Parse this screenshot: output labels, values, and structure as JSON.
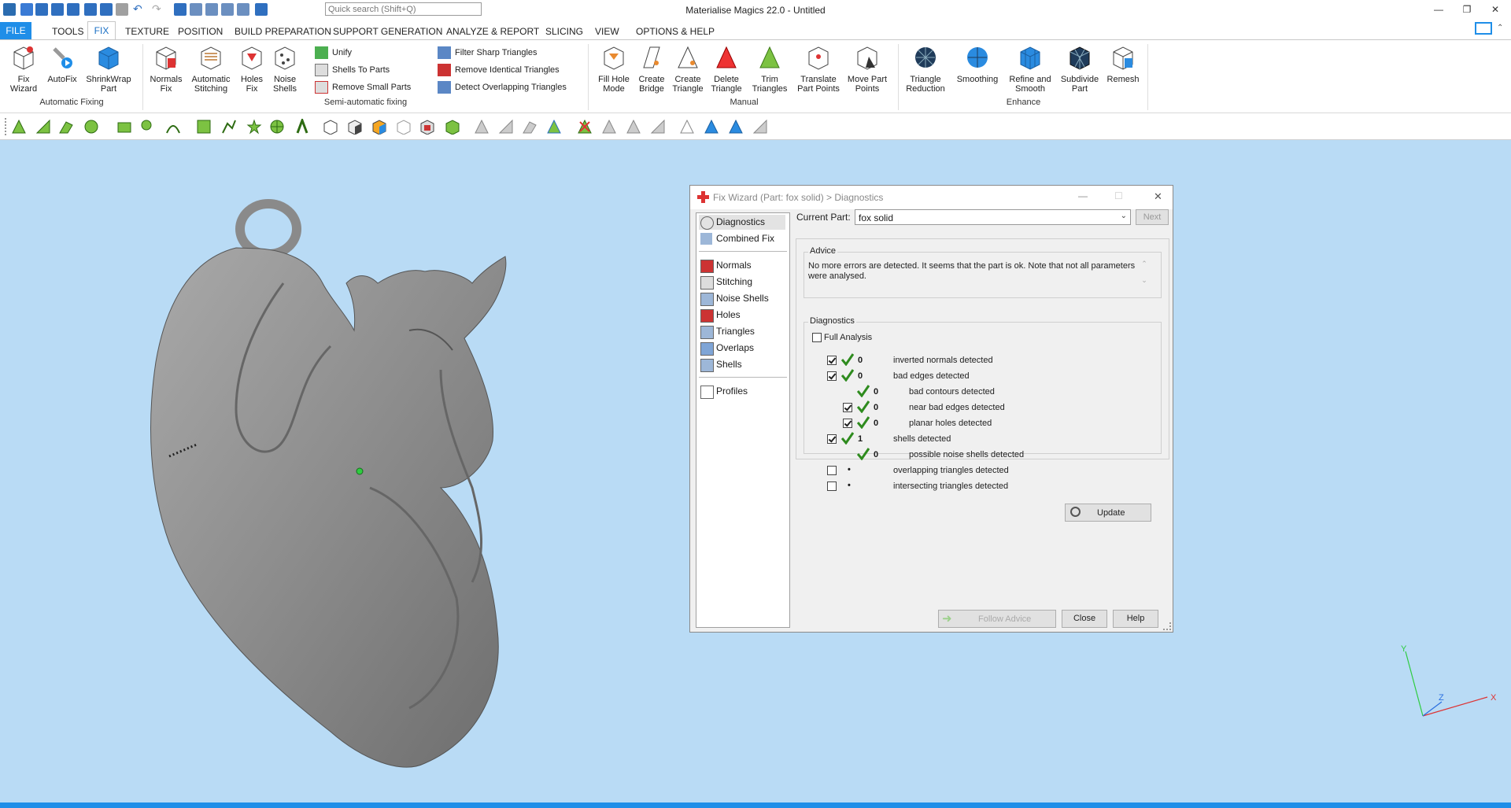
{
  "window": {
    "title": "Materialise Magics 22.0 - Untitled",
    "search_placeholder": "Quick search (Shift+Q)"
  },
  "menu": [
    "FILE",
    "TOOLS",
    "FIX",
    "TEXTURE",
    "POSITION",
    "BUILD PREPARATION",
    "SUPPORT GENERATION",
    "ANALYZE & REPORT",
    "SLICING",
    "VIEW",
    "OPTIONS & HELP"
  ],
  "ribbon": {
    "automatic": {
      "label": "Automatic Fixing",
      "buttons": [
        "Fix\nWizard",
        "AutoFix",
        "ShrinkWrap\nPart"
      ]
    },
    "semi": {
      "label": "Semi-automatic fixing",
      "buttons": [
        "Normals\nFix",
        "Automatic\nStitching",
        "Holes\nFix",
        "Noise\nShells"
      ],
      "small": [
        "Unify",
        "Shells To Parts",
        "Remove Small Parts",
        "Filter Sharp Triangles",
        "Remove Identical Triangles",
        "Detect Overlapping Triangles"
      ]
    },
    "manual": {
      "label": "Manual",
      "buttons": [
        "Fill Hole\nMode",
        "Create\nBridge",
        "Create\nTriangle",
        "Delete\nTriangle",
        "Trim\nTriangles",
        "Translate\nPart Points",
        "Move Part\nPoints"
      ]
    },
    "enhance": {
      "label": "Enhance",
      "buttons": [
        "Triangle\nReduction",
        "Smoothing",
        "Refine and\nSmooth",
        "Subdivide\nPart",
        "Remesh"
      ]
    }
  },
  "dialog": {
    "title": "Fix Wizard (Part: fox solid) > Diagnostics",
    "nav": [
      "Diagnostics",
      "Combined Fix",
      "Normals",
      "Stitching",
      "Noise Shells",
      "Holes",
      "Triangles",
      "Overlaps",
      "Shells",
      "Profiles"
    ],
    "current_part_label": "Current Part:",
    "current_part": "fox solid",
    "next_label": "Next",
    "advice_label": "Advice",
    "advice_text": "No more errors are detected. It seems that the part is ok. Note that not all parameters were analysed.",
    "diagnostics_label": "Diagnostics",
    "full_analysis_label": "Full Analysis",
    "rows": [
      {
        "count": "0",
        "label": "inverted normals detected"
      },
      {
        "count": "0",
        "label": "bad edges detected"
      },
      {
        "count": "0",
        "label": "bad contours detected"
      },
      {
        "count": "0",
        "label": "near bad edges detected"
      },
      {
        "count": "0",
        "label": "planar holes detected"
      },
      {
        "count": "1",
        "label": "shells detected"
      },
      {
        "count": "0",
        "label": "possible noise shells detected"
      },
      {
        "count": "•",
        "label": "overlapping triangles detected"
      },
      {
        "count": "•",
        "label": "intersecting triangles detected"
      }
    ],
    "update_label": "Update",
    "follow_label": "Follow Advice",
    "close_label": "Close",
    "help_label": "Help"
  },
  "axes": {
    "x": "X",
    "y": "Y",
    "z": "Z"
  },
  "colors": {
    "accent": "#1f8ee8",
    "viewport": "#b9dbf5",
    "check": "#2e8b1e"
  }
}
